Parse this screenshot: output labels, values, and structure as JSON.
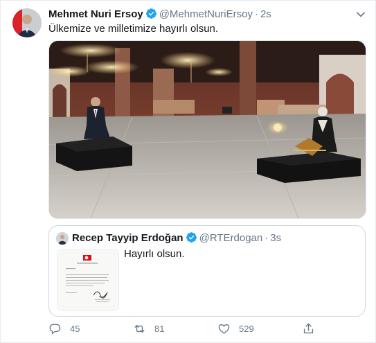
{
  "tweet": {
    "author_name": "Mehmet Nuri Ersoy",
    "handle": "@MehmetNuriErsoy",
    "separator": "·",
    "time": "2s",
    "text": "Ülkemize ve milletimize hayırlı olsun."
  },
  "quoted_tweet": {
    "author_name": "Recep Tayyip Erdoğan",
    "handle": "@RTErdogan",
    "separator": "·",
    "time": "3s",
    "text": "Hayırlı olsun."
  },
  "actions": {
    "reply_count": "45",
    "retweet_count": "81",
    "like_count": "529"
  },
  "colors": {
    "verified": "#1da1f2",
    "secondary_text": "#657786",
    "border": "#ccd6dd"
  },
  "icons": [
    "verified-badge-icon",
    "chevron-down-icon",
    "reply-icon",
    "retweet-icon",
    "like-icon",
    "share-icon"
  ]
}
